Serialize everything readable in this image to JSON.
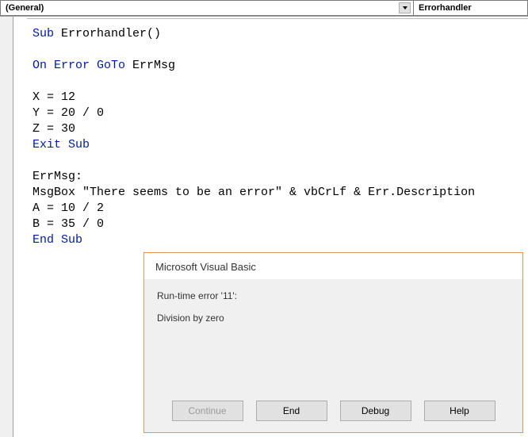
{
  "toolbar": {
    "object_dropdown": "(General)",
    "procedure_dropdown": "Errorhandler"
  },
  "code": {
    "line1": {
      "kw": "Sub ",
      "id": "Errorhandler()"
    },
    "line3": {
      "kw": "On Error GoTo ",
      "lbl": "ErrMsg"
    },
    "line5": "X = 12",
    "line6": "Y = 20 / 0",
    "line7": "Z = 30",
    "line8_kw": "Exit Sub",
    "line10": "ErrMsg:",
    "line11": "MsgBox \"There seems to be an error\" & vbCrLf & Err.Description ",
    "line12": "A = 10 / 2",
    "line13": "B = 35 / 0",
    "line14_kw": "End Sub"
  },
  "dialog": {
    "title": "Microsoft Visual Basic",
    "error_line": "Run-time error '11':",
    "error_desc": "Division by zero",
    "buttons": {
      "continue": "Continue",
      "end": "End",
      "debug": "Debug",
      "help": "Help"
    }
  }
}
